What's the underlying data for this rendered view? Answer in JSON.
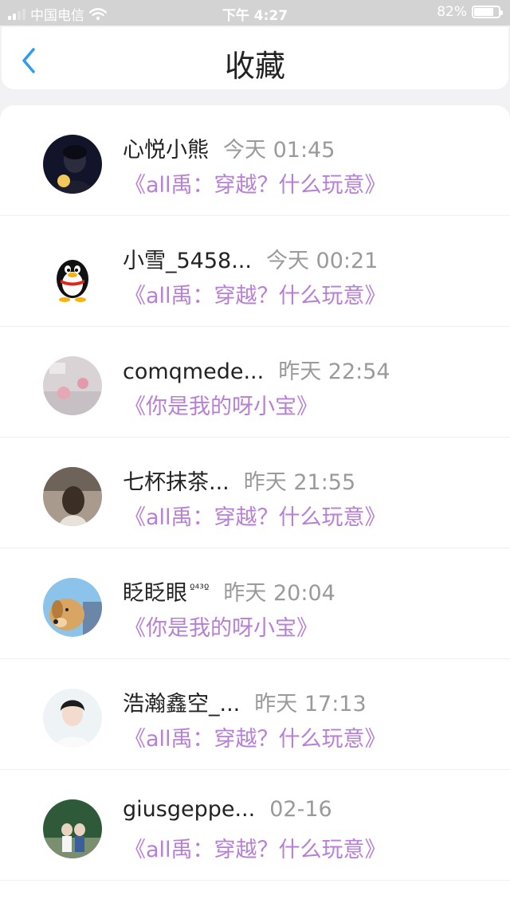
{
  "status_bar": {
    "carrier": "中国电信",
    "time": "下午 4:27",
    "battery": "82%",
    "battery_level": 0.82
  },
  "nav": {
    "title": "收藏",
    "back_icon": "chevron-left-icon"
  },
  "items": [
    {
      "name": "心悦小熊",
      "label": "",
      "time": "今天 01:45",
      "work": "《all禹：穿越？什么玩意》"
    },
    {
      "name": "小雪_5458...",
      "label": "",
      "time": "今天 00:21",
      "work": "《all禹：穿越？什么玩意》"
    },
    {
      "name": "comqmede...",
      "label": "",
      "time": "昨天 22:54",
      "work": "《你是我的呀小宝》"
    },
    {
      "name": "七杯抹茶...",
      "label": "",
      "time": "昨天 21:55",
      "work": "《all禹：穿越？什么玩意》"
    },
    {
      "name": "眨眨眼",
      "label": "º⁴³º",
      "time": "昨天 20:04",
      "work": "《你是我的呀小宝》"
    },
    {
      "name": "浩瀚鑫空_...",
      "label": "",
      "time": "昨天 17:13",
      "work": "《all禹：穿越？什么玩意》"
    },
    {
      "name": "giusgeppe...",
      "label": "",
      "time": "02-16",
      "work": "《all禹：穿越？什么玩意》"
    }
  ],
  "colors": {
    "accent_blue": "#2f9cf0",
    "work_title_purple": "#b77fd6",
    "status_bar_bg": "#d3d3d3"
  }
}
